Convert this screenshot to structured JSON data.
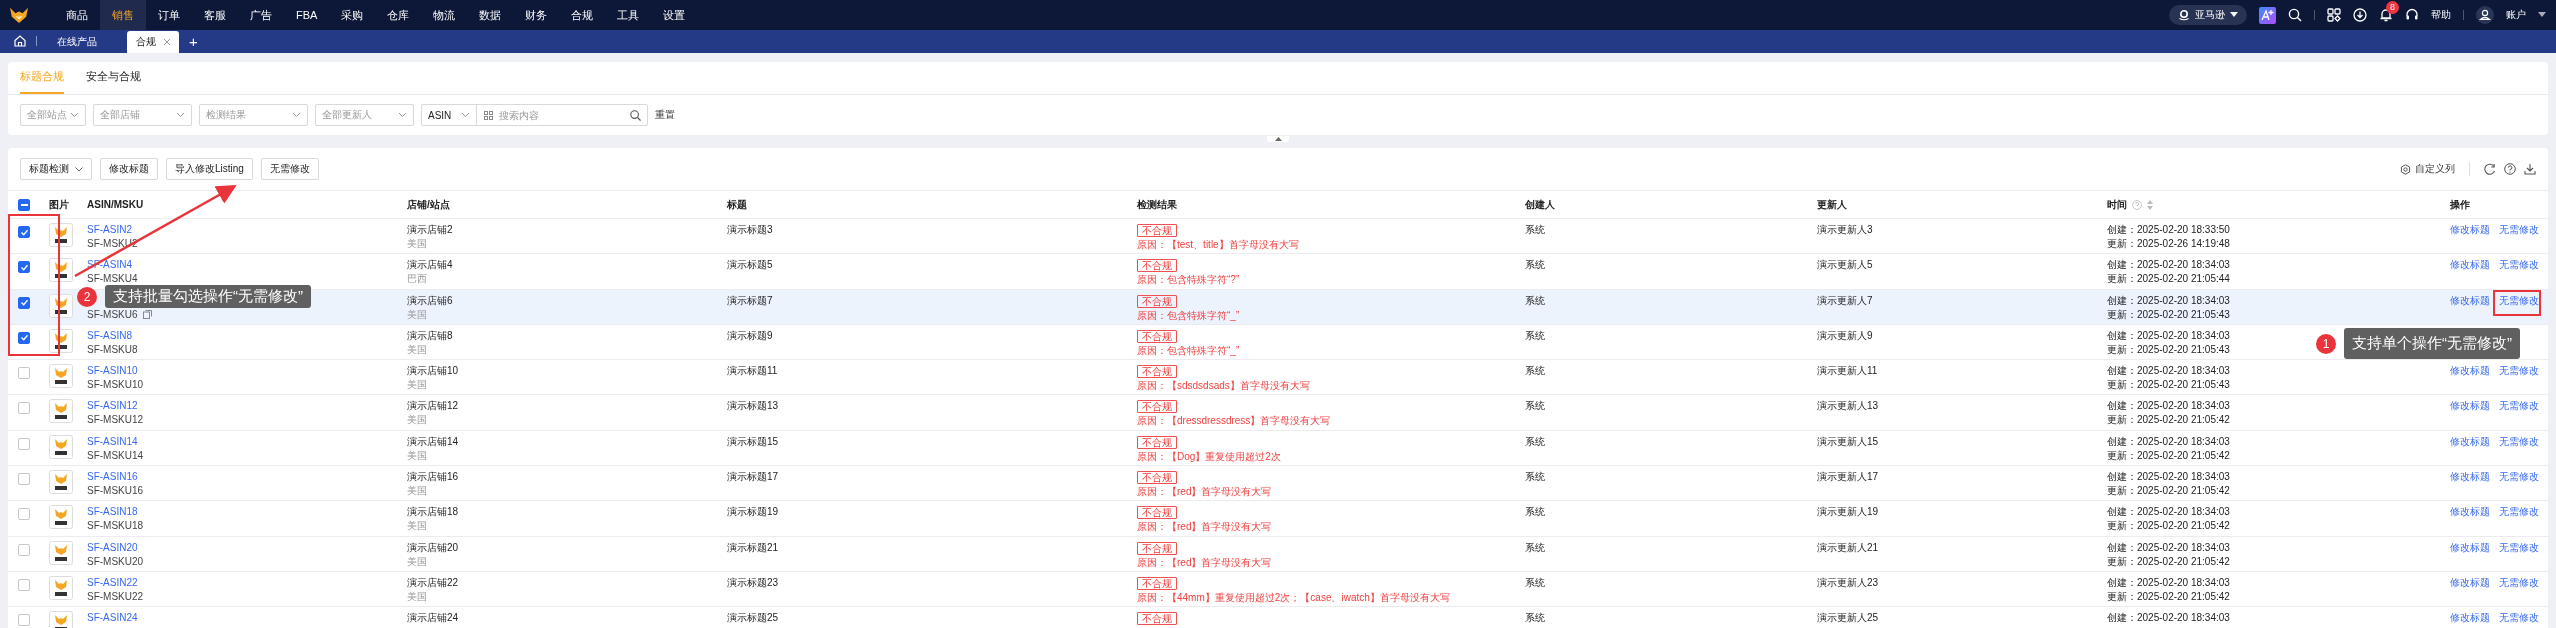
{
  "nav": {
    "items": [
      {
        "label": "商品",
        "selected": false
      },
      {
        "label": "销售",
        "selected": true
      },
      {
        "label": "订单",
        "selected": false
      },
      {
        "label": "客服",
        "selected": false
      },
      {
        "label": "广告",
        "selected": false
      },
      {
        "label": "FBA",
        "selected": false
      },
      {
        "label": "采购",
        "selected": false
      },
      {
        "label": "仓库",
        "selected": false
      },
      {
        "label": "物流",
        "selected": false
      },
      {
        "label": "数据",
        "selected": false
      },
      {
        "label": "财务",
        "selected": false
      },
      {
        "label": "合规",
        "selected": false
      },
      {
        "label": "工具",
        "selected": false
      },
      {
        "label": "设置",
        "selected": false
      }
    ],
    "marketplace": "亚马逊",
    "notification_count": "8",
    "help": "帮助",
    "account": "账户"
  },
  "page_tabs": [
    {
      "label": "在线产品",
      "selected": false,
      "closable": false
    },
    {
      "label": "合规",
      "selected": true,
      "closable": true
    }
  ],
  "add_tab": "+",
  "sub_tabs": [
    {
      "label": "标题合规",
      "selected": true
    },
    {
      "label": "安全与合规",
      "selected": false
    }
  ],
  "filters": [
    {
      "kind": "select",
      "placeholder": "全部站点"
    },
    {
      "kind": "select",
      "placeholder": "全部店铺"
    },
    {
      "kind": "select",
      "placeholder": "检测结果"
    },
    {
      "kind": "select",
      "placeholder": "全部更新人"
    },
    {
      "kind": "search_type",
      "value": "ASIN"
    },
    {
      "kind": "search",
      "placeholder": "搜索内容"
    }
  ],
  "reset": "重置",
  "toolbar": {
    "buttons": [
      {
        "label": "标题检测",
        "kind": "dropdown"
      },
      {
        "label": "修改标题",
        "kind": "plain"
      },
      {
        "label": "导入修改Listing",
        "kind": "plain"
      },
      {
        "label": "无需修改",
        "kind": "plain"
      }
    ],
    "customize": "自定义列"
  },
  "table": {
    "select_all_indeterminate": true,
    "columns": [
      "图片",
      "ASIN/MSKU",
      "店铺/站点",
      "标题",
      "检测结果",
      "创建人",
      "更新人",
      "时间",
      "操作"
    ],
    "rows": [
      {
        "checked": true,
        "hovered": false,
        "asin": "SF-ASIN2",
        "msku": "SF-MSKU2",
        "shop": "演示店铺2",
        "site": "美国",
        "title": "演示标题3",
        "result": "不合规",
        "reason": "原因：【test、title】首字母没有大写",
        "creator": "系统",
        "updater": "演示更新人3",
        "created": "创建：2025-02-20 18:33:50",
        "updated": "更新：2025-02-26 14:19:48",
        "actions": [
          "修改标题",
          "无需修改"
        ]
      },
      {
        "checked": true,
        "hovered": false,
        "asin": "SF-ASIN4",
        "msku": "SF-MSKU4",
        "shop": "演示店铺4",
        "site": "巴西",
        "title": "演示标题5",
        "result": "不合规",
        "reason": "原因：包含特殊字符“?”",
        "creator": "系统",
        "updater": "演示更新人5",
        "created": "创建：2025-02-20 18:34:03",
        "updated": "更新：2025-02-20 21:05:44",
        "actions": [
          "修改标题",
          "无需修改"
        ]
      },
      {
        "checked": true,
        "hovered": true,
        "msku": "SF-MSKU6",
        "shop": "演示店铺6",
        "site": "美国",
        "title": "演示标题7",
        "result": "不合规",
        "reason": "原因：包含特殊字符“_”",
        "creator": "系统",
        "updater": "演示更新人7",
        "created": "创建：2025-02-20 18:34:03",
        "updated": "更新：2025-02-20 21:05:43",
        "actions": [
          "修改标题",
          "无需修改"
        ]
      },
      {
        "checked": true,
        "hovered": false,
        "asin": "SF-ASIN8",
        "msku": "SF-MSKU8",
        "shop": "演示店铺8",
        "site": "美国",
        "title": "演示标题9",
        "result": "不合规",
        "reason": "原因：包含特殊字符“_”",
        "creator": "系统",
        "updater": "演示更新人9",
        "created": "创建：2025-02-20 18:34:03",
        "updated": "更新：2025-02-20 21:05:43",
        "actions": []
      },
      {
        "checked": false,
        "hovered": false,
        "asin": "SF-ASIN10",
        "msku": "SF-MSKU10",
        "shop": "演示店铺10",
        "site": "美国",
        "title": "演示标题11",
        "result": "不合规",
        "reason": "原因：【sdsdsdsads】首字母没有大写",
        "creator": "系统",
        "updater": "演示更新人11",
        "created": "创建：2025-02-20 18:34:03",
        "updated": "更新：2025-02-20 21:05:43",
        "actions": [
          "修改标题",
          "无需修改"
        ]
      },
      {
        "checked": false,
        "hovered": false,
        "asin": "SF-ASIN12",
        "msku": "SF-MSKU12",
        "shop": "演示店铺12",
        "site": "美国",
        "title": "演示标题13",
        "result": "不合规",
        "reason": "原因：【dressdressdress】首字母没有大写",
        "creator": "系统",
        "updater": "演示更新人13",
        "created": "创建：2025-02-20 18:34:03",
        "updated": "更新：2025-02-20 21:05:42",
        "actions": [
          "修改标题",
          "无需修改"
        ]
      },
      {
        "checked": false,
        "hovered": false,
        "asin": "SF-ASIN14",
        "msku": "SF-MSKU14",
        "shop": "演示店铺14",
        "site": "美国",
        "title": "演示标题15",
        "result": "不合规",
        "reason": "原因：【Dog】重复使用超过2次",
        "creator": "系统",
        "updater": "演示更新人15",
        "created": "创建：2025-02-20 18:34:03",
        "updated": "更新：2025-02-20 21:05:42",
        "actions": [
          "修改标题",
          "无需修改"
        ]
      },
      {
        "checked": false,
        "hovered": false,
        "asin": "SF-ASIN16",
        "msku": "SF-MSKU16",
        "shop": "演示店铺16",
        "site": "美国",
        "title": "演示标题17",
        "result": "不合规",
        "reason": "原因：【red】首字母没有大写",
        "creator": "系统",
        "updater": "演示更新人17",
        "created": "创建：2025-02-20 18:34:03",
        "updated": "更新：2025-02-20 21:05:42",
        "actions": [
          "修改标题",
          "无需修改"
        ]
      },
      {
        "checked": false,
        "hovered": false,
        "asin": "SF-ASIN18",
        "msku": "SF-MSKU18",
        "shop": "演示店铺18",
        "site": "美国",
        "title": "演示标题19",
        "result": "不合规",
        "reason": "原因：【red】首字母没有大写",
        "creator": "系统",
        "updater": "演示更新人19",
        "created": "创建：2025-02-20 18:34:03",
        "updated": "更新：2025-02-20 21:05:42",
        "actions": [
          "修改标题",
          "无需修改"
        ]
      },
      {
        "checked": false,
        "hovered": false,
        "asin": "SF-ASIN20",
        "msku": "SF-MSKU20",
        "shop": "演示店铺20",
        "site": "美国",
        "title": "演示标题21",
        "result": "不合规",
        "reason": "原因：【red】首字母没有大写",
        "creator": "系统",
        "updater": "演示更新人21",
        "created": "创建：2025-02-20 18:34:03",
        "updated": "更新：2025-02-20 21:05:42",
        "actions": [
          "修改标题",
          "无需修改"
        ]
      },
      {
        "checked": false,
        "hovered": false,
        "asin": "SF-ASIN22",
        "msku": "SF-MSKU22",
        "shop": "演示店铺22",
        "site": "美国",
        "title": "演示标题23",
        "result": "不合规",
        "reason": "原因：【44mm】重复使用超过2次；【case、iwatch】首字母没有大写",
        "creator": "系统",
        "updater": "演示更新人23",
        "created": "创建：2025-02-20 18:34:03",
        "updated": "更新：2025-02-20 21:05:42",
        "actions": [
          "修改标题",
          "无需修改"
        ]
      },
      {
        "checked": false,
        "hovered": false,
        "asin": "SF-ASIN24",
        "shop": "演示店铺24",
        "title": "演示标题25",
        "result": "不合规",
        "creator": "系统",
        "updater": "演示更新人25",
        "created": "创建：2025-02-20 18:34:03",
        "actions": [
          "修改标题",
          "无需修改"
        ]
      }
    ]
  },
  "annotations": [
    {
      "number": "2",
      "text": "支持批量勾选操作“无需修改”"
    },
    {
      "number": "1",
      "text": "支持单个操作“无需修改”"
    }
  ]
}
